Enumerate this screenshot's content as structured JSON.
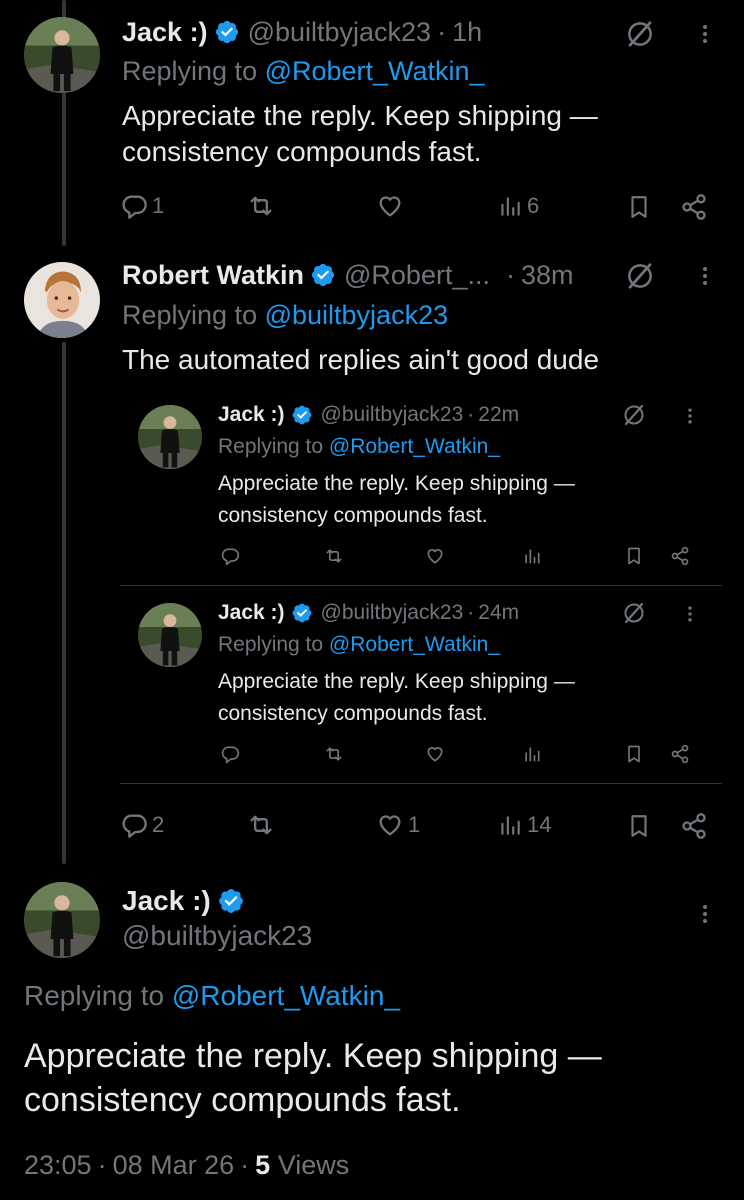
{
  "tweets": [
    {
      "name": "Jack :)",
      "handle": "@builtbyjack23",
      "time": "1h",
      "replying_prefix": "Replying to ",
      "replying_to": "@Robert_Watkin_",
      "text": "Appreciate the reply. Keep shipping — consistency compounds fast.",
      "reply_count": "1",
      "retweet_count": "",
      "like_count": "",
      "views": "6"
    },
    {
      "name": "Robert Watkin",
      "handle": "@Robert_...",
      "time": "38m",
      "replying_prefix": "Replying to ",
      "replying_to": "@builtbyjack23",
      "text": "The automated replies ain't good dude",
      "reply_count": "2",
      "retweet_count": "",
      "like_count": "1",
      "views": "14"
    }
  ],
  "quoted": [
    {
      "name": "Jack :)",
      "handle": "@builtbyjack23",
      "time": "22m",
      "replying_prefix": "Replying to ",
      "replying_to": "@Robert_Watkin_",
      "text": "Appreciate the reply. Keep shipping — consistency compounds fast."
    },
    {
      "name": "Jack :)",
      "handle": "@builtbyjack23",
      "time": "24m",
      "replying_prefix": "Replying to ",
      "replying_to": "@Robert_Watkin_",
      "text": "Appreciate the reply. Keep shipping — consistency compounds fast."
    }
  ],
  "main": {
    "name": "Jack :)",
    "handle": "@builtbyjack23",
    "replying_prefix": "Replying to ",
    "replying_to": "@Robert_Watkin_",
    "text": "Appreciate the reply. Keep shipping — consistency compounds fast.",
    "time": "23:05",
    "date": "08 Mar 26",
    "views_count": "5",
    "views_label": "Views"
  },
  "colors": {
    "accent": "#1d9bf0",
    "muted": "#71767b",
    "text": "#e7e9ea",
    "background": "#000000"
  },
  "icons": [
    "verified-badge-icon",
    "grok-icon",
    "more-icon",
    "reply-icon",
    "retweet-icon",
    "like-icon",
    "views-icon",
    "bookmark-icon",
    "share-icon"
  ]
}
